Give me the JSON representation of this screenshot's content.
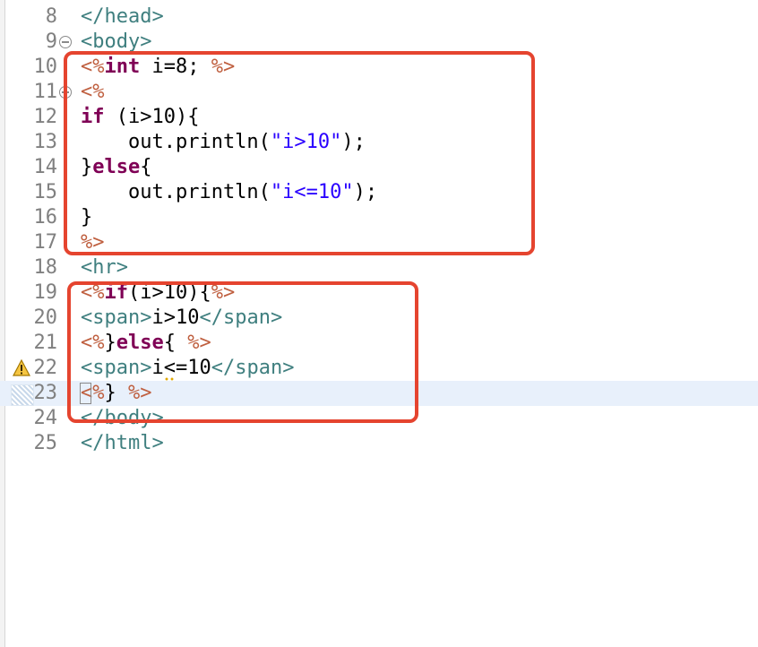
{
  "colors": {
    "keyword": "#7f0055",
    "tag": "#3f7f7f",
    "jsp_delimiter": "#bf5f3f",
    "string": "#2a00ff",
    "highlight_box": "#e5442f",
    "current_line": "#e8f0fb"
  },
  "lines": [
    {
      "num": "8",
      "tokens": [
        {
          "t": "tag",
          "v": "</head>"
        }
      ]
    },
    {
      "num": "9",
      "tokens": [
        {
          "t": "tag",
          "v": "<body>"
        }
      ]
    },
    {
      "num": "10",
      "tokens": [
        {
          "t": "jsp",
          "v": "<%"
        },
        {
          "t": "kw",
          "v": "int"
        },
        {
          "t": "txt",
          "v": " i=8; "
        },
        {
          "t": "jsp",
          "v": "%>"
        }
      ]
    },
    {
      "num": "11",
      "tokens": [
        {
          "t": "jsp",
          "v": "<%"
        }
      ]
    },
    {
      "num": "12",
      "tokens": [
        {
          "t": "kw",
          "v": "if"
        },
        {
          "t": "txt",
          "v": " (i>10){"
        }
      ]
    },
    {
      "num": "13",
      "tokens": [
        {
          "t": "txt",
          "v": "    out.println("
        },
        {
          "t": "str",
          "v": "\"i>10\""
        },
        {
          "t": "txt",
          "v": ");"
        }
      ]
    },
    {
      "num": "14",
      "tokens": [
        {
          "t": "txt",
          "v": "}"
        },
        {
          "t": "kw",
          "v": "else"
        },
        {
          "t": "txt",
          "v": "{"
        }
      ]
    },
    {
      "num": "15",
      "tokens": [
        {
          "t": "txt",
          "v": "    out.println("
        },
        {
          "t": "str",
          "v": "\"i<=10\""
        },
        {
          "t": "txt",
          "v": ");"
        }
      ]
    },
    {
      "num": "16",
      "tokens": [
        {
          "t": "txt",
          "v": "}"
        }
      ]
    },
    {
      "num": "17",
      "tokens": [
        {
          "t": "jsp",
          "v": "%>"
        }
      ]
    },
    {
      "num": "18",
      "tokens": [
        {
          "t": "tag",
          "v": "<hr>"
        }
      ]
    },
    {
      "num": "19",
      "tokens": [
        {
          "t": "jsp",
          "v": "<%"
        },
        {
          "t": "kw",
          "v": "if"
        },
        {
          "t": "txt",
          "v": "(i>10){"
        },
        {
          "t": "jsp",
          "v": "%>"
        }
      ]
    },
    {
      "num": "20",
      "tokens": [
        {
          "t": "tag",
          "v": "<span>"
        },
        {
          "t": "txt",
          "v": "i>10"
        },
        {
          "t": "tag",
          "v": "</span>"
        }
      ]
    },
    {
      "num": "21",
      "tokens": [
        {
          "t": "jsp",
          "v": "<%"
        },
        {
          "t": "txt",
          "v": "}"
        },
        {
          "t": "kw",
          "v": "else"
        },
        {
          "t": "txt",
          "v": "{ "
        },
        {
          "t": "jsp",
          "v": "%>"
        }
      ]
    },
    {
      "num": "22",
      "tokens": [
        {
          "t": "tag",
          "v": "<span>"
        },
        {
          "t": "txt",
          "v": "i<=10"
        },
        {
          "t": "tag",
          "v": "</span>"
        }
      ]
    },
    {
      "num": "23",
      "tokens": [
        {
          "t": "jsp",
          "v": "<%"
        },
        {
          "t": "txt",
          "v": "} "
        },
        {
          "t": "jsp",
          "v": "%>"
        }
      ]
    },
    {
      "num": "24",
      "tokens": [
        {
          "t": "tag",
          "v": "</body>"
        }
      ]
    },
    {
      "num": "25",
      "tokens": [
        {
          "t": "tag",
          "v": "</html>"
        }
      ]
    }
  ],
  "fold_lines": [
    "9",
    "11"
  ],
  "warning_line": "22",
  "warning_icon": "warning-triangle-icon",
  "current_line": "23",
  "highlight_boxes": [
    "java-scriptlet-block",
    "mixed-jsp-html-block"
  ]
}
